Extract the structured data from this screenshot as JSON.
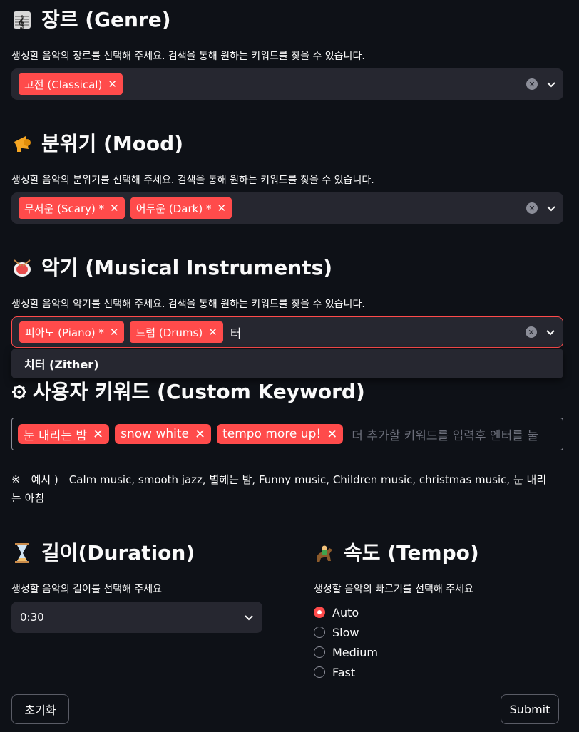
{
  "genre": {
    "title": "장르 (Genre)",
    "icon": "musical-score-icon",
    "desc": "생성할 음악의 장르를 선택해 주세요. 검색을 통해 원하는 키워드를 찾을 수 있습니다.",
    "tags": [
      "고전 (Classical)"
    ]
  },
  "mood": {
    "title": "분위기 (Mood)",
    "icon": "megaphone-icon",
    "desc": "생성할 음악의 분위기를 선택해 주세요. 검색을 통해 원하는 키워드를 찾을 수 있습니다.",
    "tags": [
      "무서운 (Scary) *",
      "어두운 (Dark) *"
    ]
  },
  "instruments": {
    "title": "악기 (Musical Instruments)",
    "icon": "drum-icon",
    "desc": "생성할 음악의 악기를 선택해 주세요. 검색을 통해 원하는 키워드를 찾을 수 있습니다.",
    "tags": [
      "피아노 (Piano) *",
      "드럼 (Drums)"
    ],
    "typed": "터",
    "dropdown_option": "치터 (Zither)"
  },
  "custom": {
    "title": "사용자 키워드 (Custom Keyword)",
    "icon": "gear-icon",
    "tags": [
      "눈 내리는 밤",
      "snow white",
      "tempo more up!"
    ],
    "placeholder": "더 추가할 키워드를 입력후 엔터를 눌",
    "example_line1": "※　예시 )　Calm music, smooth jazz, 별헤는 밤, Funny music, Children music, christmas music, 눈 내리",
    "example_line2": "는 아침"
  },
  "duration": {
    "title": "길이(Duration)",
    "icon": "hourglass-icon",
    "desc": "생성할 음악의 길이를 선택해 주세요",
    "value": "0:30"
  },
  "tempo": {
    "title": "속도 (Tempo)",
    "icon": "horse-racing-icon",
    "desc": "생성할 음악의 빠르기를 선택해 주세요",
    "options": [
      "Auto",
      "Slow",
      "Medium",
      "Fast"
    ],
    "selected": "Auto"
  },
  "buttons": {
    "reset": "초기화",
    "submit": "Submit"
  },
  "colors": {
    "accent": "#ff4b4b",
    "bg": "#0e1117",
    "widget": "#262730"
  }
}
